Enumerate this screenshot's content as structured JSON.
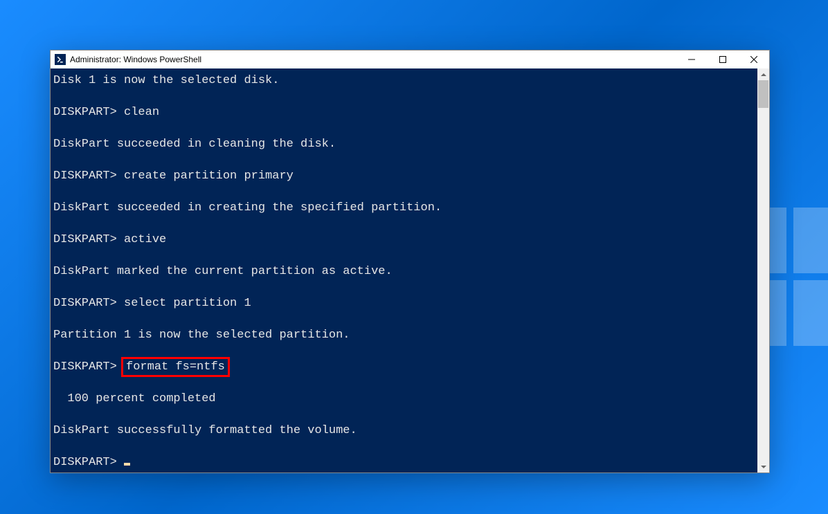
{
  "window": {
    "title": "Administrator: Windows PowerShell"
  },
  "terminal": {
    "lines": [
      "Disk 1 is now the selected disk.",
      "",
      "DISKPART> clean",
      "",
      "DiskPart succeeded in cleaning the disk.",
      "",
      "DISKPART> create partition primary",
      "",
      "DiskPart succeeded in creating the specified partition.",
      "",
      "DISKPART> active",
      "",
      "DiskPart marked the current partition as active.",
      "",
      "DISKPART> select partition 1",
      "",
      "Partition 1 is now the selected partition.",
      ""
    ],
    "format_line_prefix": "DISKPART> ",
    "format_line_highlighted": "format fs=ntfs",
    "lines_after": [
      "",
      "  100 percent completed",
      "",
      "DiskPart successfully formatted the volume.",
      ""
    ],
    "final_prompt": "DISKPART> "
  }
}
